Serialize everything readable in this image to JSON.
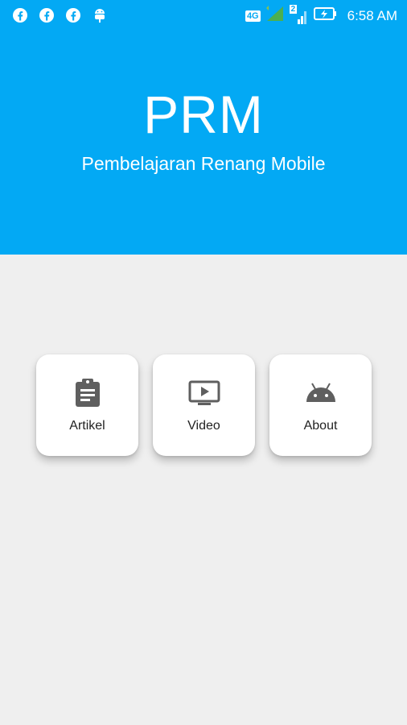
{
  "status_bar": {
    "left_icons": [
      "facebook-icon",
      "facebook-icon",
      "facebook-icon",
      "android-debug-icon"
    ],
    "network": "4G",
    "sim_label": "2",
    "time": "6:58 AM"
  },
  "header": {
    "title": "PRM",
    "subtitle": "Pembelajaran Renang Mobile",
    "background_color": "#03a9f4"
  },
  "menu": {
    "items": [
      {
        "label": "Artikel",
        "icon": "clipboard-icon"
      },
      {
        "label": "Video",
        "icon": "tv-play-icon"
      },
      {
        "label": "About",
        "icon": "android-icon"
      }
    ]
  }
}
